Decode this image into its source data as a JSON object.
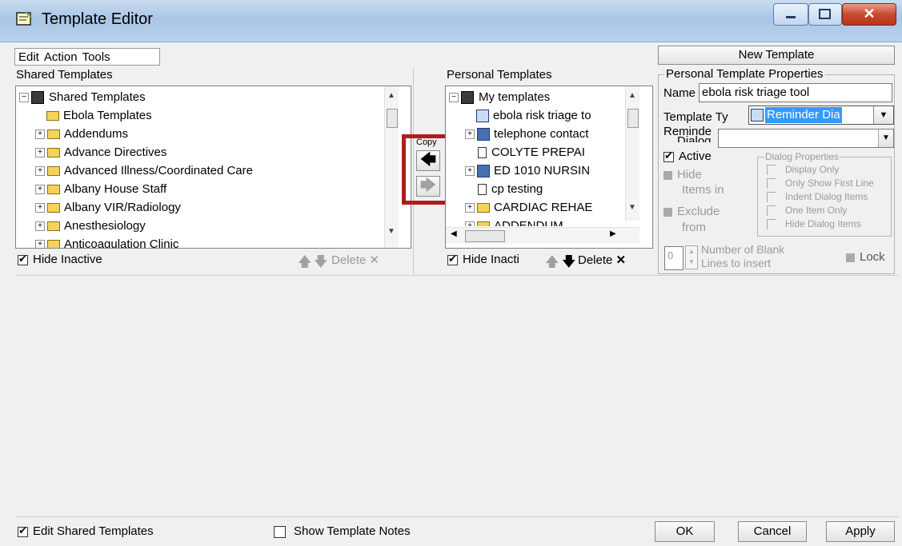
{
  "window": {
    "title": "Template Editor"
  },
  "menu": [
    "Edit",
    "Action",
    "Tools"
  ],
  "shared": {
    "label": "Shared Templates",
    "root": "Shared Templates",
    "items": [
      {
        "label": "Ebola Templates",
        "expander": ""
      },
      {
        "label": "Addendums",
        "expander": "+"
      },
      {
        "label": "Advance Directives",
        "expander": "+"
      },
      {
        "label": "Advanced Illness/Coordinated Care",
        "expander": "+"
      },
      {
        "label": "Albany House Staff",
        "expander": "+"
      },
      {
        "label": "Albany VIR/Radiology",
        "expander": "+"
      },
      {
        "label": "Anesthesiology",
        "expander": "+"
      },
      {
        "label": "Anticoagulation Clinic",
        "expander": "+"
      }
    ],
    "hide_inactive": "Hide Inactive",
    "delete": "Delete"
  },
  "copy_label": "Copy",
  "personal": {
    "label": "Personal Templates",
    "root": "My  templates",
    "items": [
      {
        "label": "ebola risk triage to",
        "icon": "reminder"
      },
      {
        "label": "telephone contact",
        "icon": "template"
      },
      {
        "label": "COLYTE PREPAI",
        "icon": "doc"
      },
      {
        "label": "ED 1010 NURSIN",
        "icon": "template"
      },
      {
        "label": "cp testing",
        "icon": "doc"
      },
      {
        "label": "CARDIAC REHAE",
        "icon": "folder"
      },
      {
        "label": "ADDENDUM",
        "icon": "folder"
      }
    ],
    "hide_inactive": "Hide Inacti",
    "delete": "Delete"
  },
  "new_template": "New Template",
  "props": {
    "group_title": "Personal Template Properties",
    "name_label": "Name",
    "name_value": "ebola risk triage tool",
    "type_label": "Template Ty",
    "type_value": "Reminder Dia",
    "reminder_label": "Reminde",
    "dialog_label": "Dialog",
    "active": "Active",
    "hide": "Hide",
    "items_in": "Items in",
    "exclude": "Exclude",
    "from": "from",
    "dialog_props_title": "Dialog Properties",
    "dialog_props": [
      "Display Only",
      "Only Show First Line",
      "Indent Dialog Items",
      "One Item Only",
      "Hide Dialog Items"
    ],
    "blank_value": "0",
    "blank_label_1": "Number of Blank",
    "blank_label_2": "Lines to insert",
    "lock": "Lock"
  },
  "bottom": {
    "edit_shared": "Edit Shared Templates",
    "show_notes": "Show Template Notes",
    "ok": "OK",
    "cancel": "Cancel",
    "apply": "Apply"
  },
  "colors": {
    "highlight_box": "#b01c1c",
    "selection": "#3399ff"
  }
}
